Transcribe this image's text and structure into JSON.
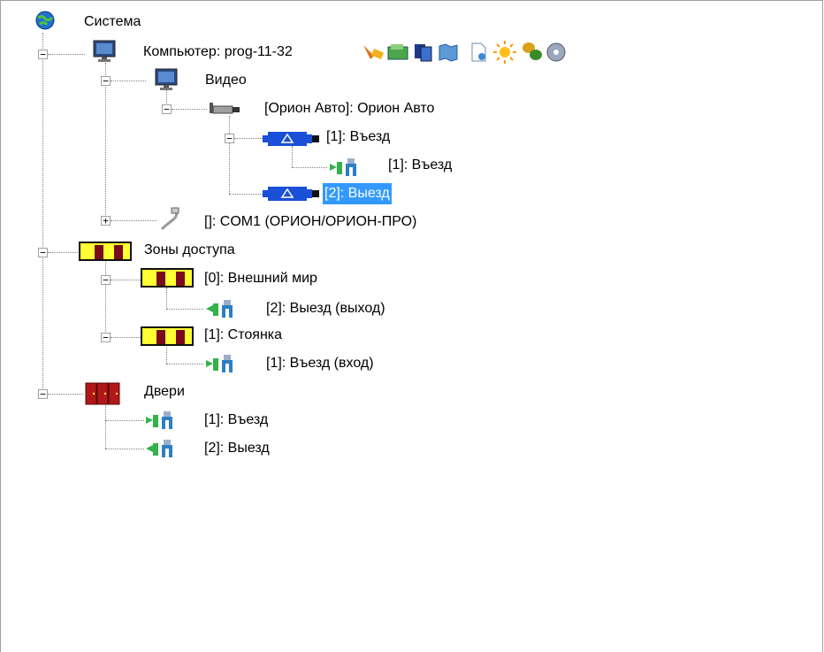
{
  "tree": {
    "root": {
      "label": "Система",
      "icon": "globe-icon"
    },
    "computer": {
      "label": "Компьютер: prog-11-32",
      "icon": "monitor-icon",
      "toolbar_icons": [
        "tools-icon",
        "folder-icon",
        "cards-icon",
        "map-icon",
        "document-icon",
        "sun-icon",
        "coins-icon",
        "disk-icon"
      ]
    },
    "video": {
      "label": "Видео",
      "icon": "monitor-icon"
    },
    "orion_auto": {
      "label": "[Орион Авто]: Орион Авто",
      "icon": "camera-icon"
    },
    "entry_camera": {
      "label": "[1]: Въезд",
      "icon": "camera-sensor-icon"
    },
    "entry_gate": {
      "label": "[1]: Въезд",
      "icon": "gate-entry-icon"
    },
    "exit_camera": {
      "label": "[2]: Выезд",
      "icon": "camera-sensor-icon",
      "selected": true
    },
    "com1": {
      "label": "[]: COM1 (ОРИОН/ОРИОН-ПРО)",
      "icon": "serial-cable-icon"
    },
    "zones": {
      "label": "Зоны доступа",
      "icon": "zone-icon"
    },
    "zone_outer": {
      "label": "[0]: Внешний мир",
      "icon": "zone-icon"
    },
    "zone_outer_exit": {
      "label": "[2]: Выезд (выход)",
      "icon": "gate-exit-icon"
    },
    "zone_parking": {
      "label": "[1]: Стоянка",
      "icon": "zone-icon"
    },
    "zone_parking_entry": {
      "label": "[1]: Въезд (вход)",
      "icon": "gate-entry-icon"
    },
    "doors": {
      "label": "Двери",
      "icon": "doors-icon"
    },
    "door_entry": {
      "label": "[1]: Въезд",
      "icon": "gate-entry-icon"
    },
    "door_exit": {
      "label": "[2]: Выезд",
      "icon": "gate-exit-icon"
    },
    "colors": {
      "selection": "#3399ff",
      "zone_yellow": "#ffff33",
      "door_red": "#b01818",
      "camera_blue": "#1a4fd8"
    }
  }
}
